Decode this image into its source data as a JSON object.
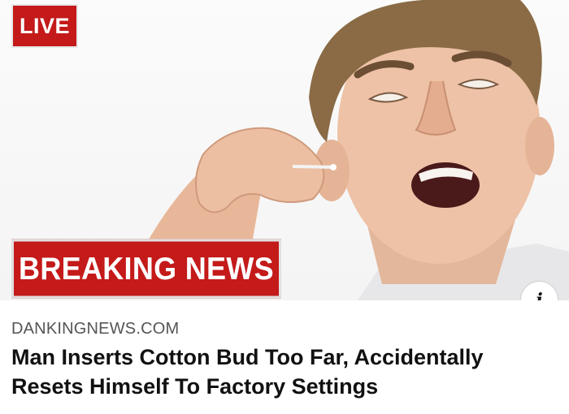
{
  "badges": {
    "live": "LIVE",
    "breaking": "BREAKING NEWS"
  },
  "info_icon": {
    "glyph": "i",
    "icon": "info-icon"
  },
  "article": {
    "source": "DANKINGNEWS.COM",
    "headline_line1": "Man Inserts Cotton Bud Too Far, Accidentally",
    "headline_line2": "Resets Himself To Factory Settings"
  },
  "colors": {
    "badge_red": "#c41a1a",
    "text_dark": "#111111",
    "text_muted": "#555555"
  }
}
